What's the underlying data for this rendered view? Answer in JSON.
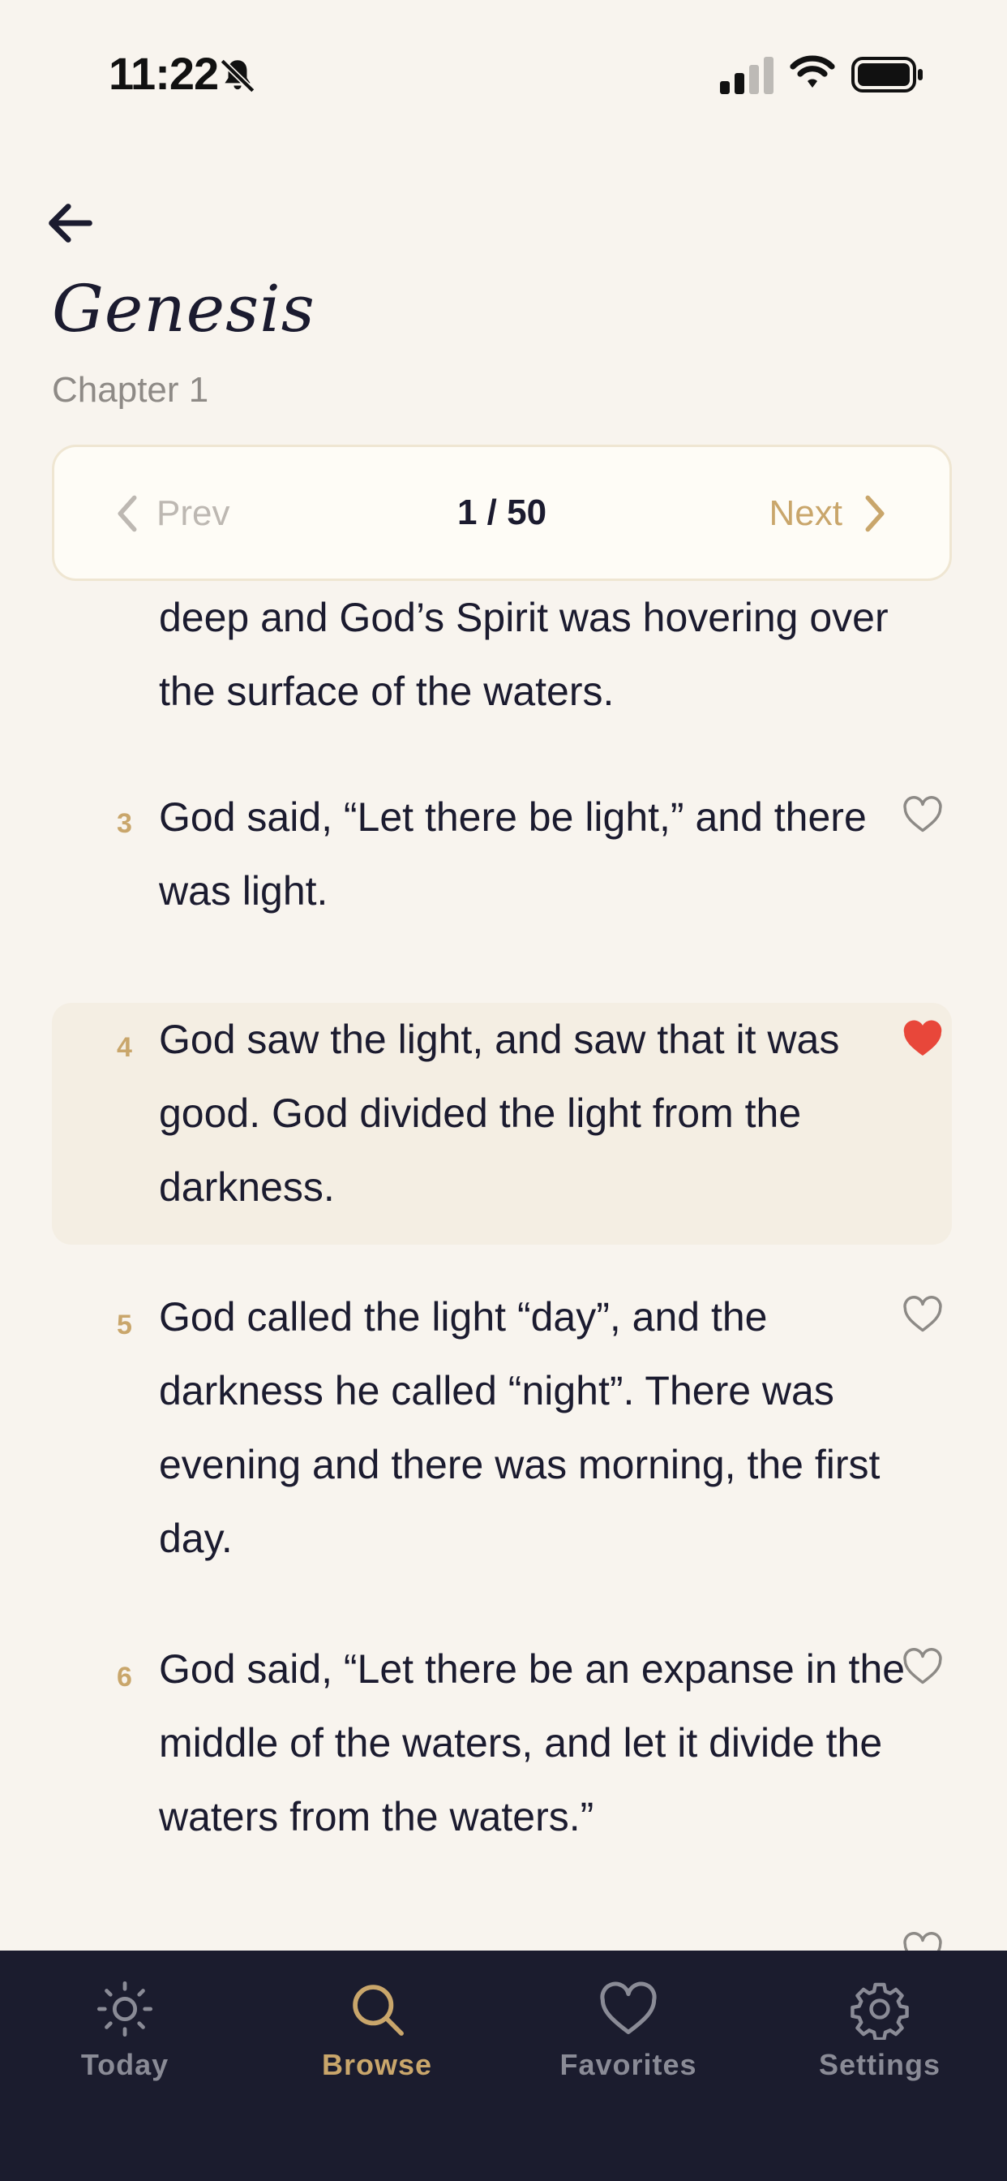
{
  "status_bar": {
    "time": "11:22",
    "icons": [
      "bell-slash-icon",
      "cellular-signal-icon",
      "wifi-icon",
      "battery-icon"
    ]
  },
  "header": {
    "back_icon": "arrow-left-icon",
    "title": "Genesis",
    "subtitle": "Chapter 1"
  },
  "pager": {
    "prev_label": "Prev",
    "next_label": "Next",
    "position": "1 / 50"
  },
  "verses": [
    {
      "number": "",
      "text": "deep and God’s Spirit was hovering over the surface of the waters.",
      "favorited": false
    },
    {
      "number": "3",
      "text": "God said, “Let there be light,” and there was light.",
      "favorited": false
    },
    {
      "number": "4",
      "text": "God saw the light, and saw that it was good. God divided the light from the darkness.",
      "favorited": true
    },
    {
      "number": "5",
      "text": "God called the light “day”, and the darkness he called “night”. There was evening and there was morning, the first day.",
      "favorited": false
    },
    {
      "number": "6",
      "text": "God said, “Let there be an expanse in the middle of the waters, and let it divide the waters from the waters.”",
      "favorited": false
    }
  ],
  "tabs": [
    {
      "label": "Today",
      "icon": "sun-icon",
      "active": false
    },
    {
      "label": "Browse",
      "icon": "search-icon",
      "active": true
    },
    {
      "label": "Favorites",
      "icon": "heart-icon",
      "active": false
    },
    {
      "label": "Settings",
      "icon": "gear-icon",
      "active": false
    }
  ],
  "colors": {
    "background": "#f8f4ee",
    "accent": "#c9a66b",
    "text": "#1b1b2f",
    "favorite": "#e8473a",
    "tab_bar": "#1b1c2e",
    "highlight": "#f4eee3"
  }
}
